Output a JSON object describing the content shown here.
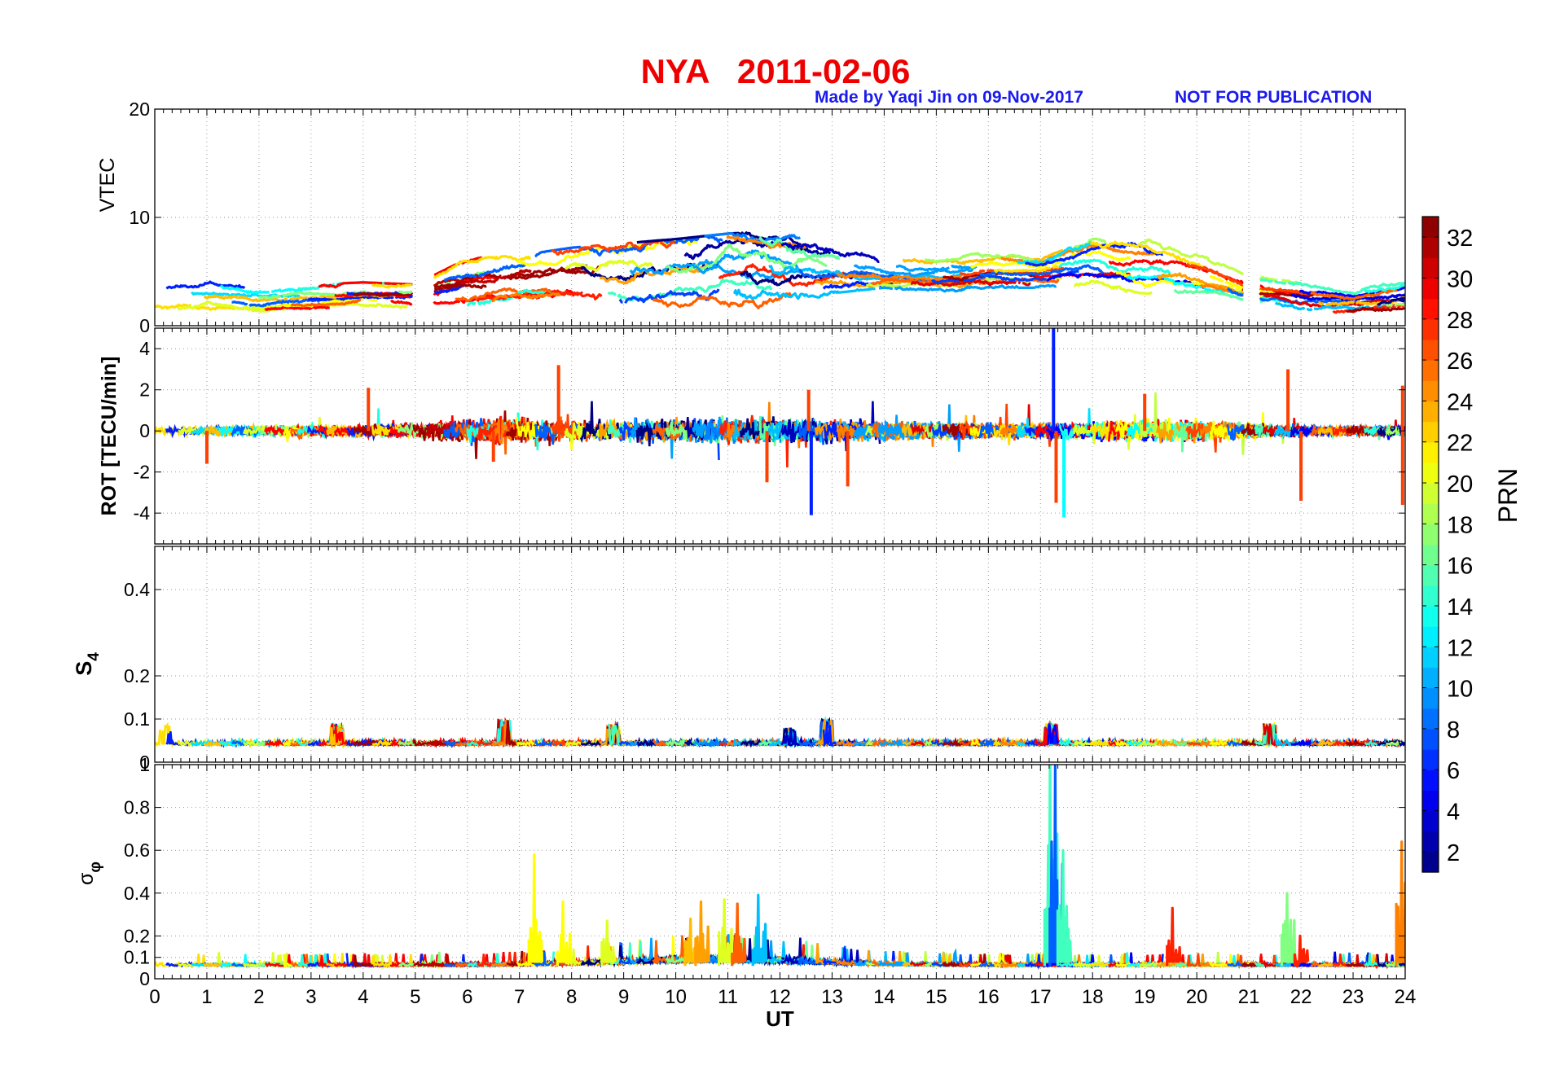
{
  "header": {
    "title": "NYA   2011-02-06",
    "credit": "Made by Yaqi Jin on 09-Nov-2017",
    "notice": "NOT FOR PUBLICATION"
  },
  "colors": {
    "title": "#ee0000",
    "annotation": "#1a1aee",
    "colormap": "jet"
  },
  "chart_data": [
    {
      "type": "line",
      "id": "vtec",
      "ylabel": "VTEC",
      "xlabel": "",
      "xlim": [
        0,
        24
      ],
      "ylim": [
        0,
        20
      ],
      "yticks": [
        0,
        10,
        20
      ],
      "grid": true,
      "series_by": "PRN",
      "envelope": {
        "x": [
          0,
          1,
          2,
          3,
          4,
          5,
          6,
          7,
          8,
          9,
          10,
          11,
          12,
          13,
          14,
          15,
          16,
          17,
          18,
          19,
          20,
          21,
          22,
          23,
          24
        ],
        "typical": [
          2.5,
          2.8,
          2.4,
          2.6,
          3.0,
          2.8,
          3.8,
          4.5,
          5.0,
          5.2,
          5.4,
          5.8,
          5.6,
          5.3,
          4.8,
          4.6,
          5.0,
          4.8,
          5.8,
          5.2,
          4.6,
          3.2,
          2.5,
          2.2,
          2.8
        ],
        "min": [
          1.2,
          1.5,
          1.3,
          1.4,
          1.6,
          1.2,
          1.5,
          1.6,
          0.8,
          0.2,
          0.5,
          0.3,
          0.8,
          3.0,
          3.5,
          3.0,
          3.5,
          3.5,
          3.2,
          3.0,
          2.5,
          1.8,
          1.0,
          1.0,
          1.5
        ],
        "max": [
          4.0,
          4.4,
          3.6,
          3.8,
          4.0,
          3.8,
          6.2,
          6.5,
          7.2,
          7.6,
          8.0,
          8.5,
          8.8,
          8.6,
          6.8,
          6.2,
          6.8,
          6.2,
          8.0,
          8.2,
          7.0,
          4.5,
          4.5,
          3.5,
          4.5
        ]
      },
      "gaps_hours": [
        [
          4.95,
          5.35
        ],
        [
          20.9,
          21.2
        ]
      ]
    },
    {
      "type": "line",
      "id": "rot",
      "ylabel": "ROT [TECU/min]",
      "xlabel": "",
      "xlim": [
        0,
        24
      ],
      "ylim": [
        -5.5,
        5
      ],
      "yticks": [
        -4,
        -2,
        0,
        2,
        4
      ],
      "grid": true,
      "series_by": "PRN",
      "spikes": [
        {
          "x": 17.25,
          "y": 5.0
        },
        {
          "x": 17.3,
          "y": -3.5
        },
        {
          "x": 17.45,
          "y": -4.2
        },
        {
          "x": 12.6,
          "y": -4.1
        },
        {
          "x": 13.3,
          "y": -2.7
        },
        {
          "x": 11.75,
          "y": -2.5
        },
        {
          "x": 21.75,
          "y": 3.0
        },
        {
          "x": 22.0,
          "y": -3.4
        },
        {
          "x": 23.95,
          "y": -3.6
        },
        {
          "x": 23.95,
          "y": 2.2
        },
        {
          "x": 7.75,
          "y": 3.2
        },
        {
          "x": 12.55,
          "y": 2.0
        },
        {
          "x": 19.0,
          "y": 1.8
        },
        {
          "x": 6.5,
          "y": -1.5
        },
        {
          "x": 4.1,
          "y": 2.1
        },
        {
          "x": 1.0,
          "y": -1.6
        }
      ]
    },
    {
      "type": "line",
      "id": "s4",
      "ylabel": "S4",
      "ylabel_main": "S",
      "ylabel_sub": "4",
      "xlabel": "",
      "xlim": [
        0,
        24
      ],
      "ylim": [
        0,
        0.5
      ],
      "yticks": [
        0,
        0.1,
        0.2,
        0.4
      ],
      "tick_labels": [
        "0",
        "0.1",
        "0.2",
        "0.4"
      ],
      "grid": true,
      "series_by": "PRN",
      "baseline": 0.04,
      "bumps": [
        {
          "x": 0.2,
          "y": 0.09
        },
        {
          "x": 3.5,
          "y": 0.09
        },
        {
          "x": 6.7,
          "y": 0.1
        },
        {
          "x": 8.8,
          "y": 0.09
        },
        {
          "x": 12.2,
          "y": 0.08
        },
        {
          "x": 12.9,
          "y": 0.1
        },
        {
          "x": 17.2,
          "y": 0.09
        },
        {
          "x": 21.4,
          "y": 0.09
        }
      ]
    },
    {
      "type": "line",
      "id": "sigma_phi",
      "ylabel": "σφ",
      "ylabel_main": "σ",
      "ylabel_sub": "φ",
      "xlabel": "UT",
      "xlim": [
        0,
        24
      ],
      "ylim": [
        0,
        1
      ],
      "yticks": [
        0,
        0.1,
        0.2,
        0.4,
        0.6,
        0.8,
        1
      ],
      "tick_labels": [
        "0",
        "0.1",
        "0.2",
        "0.4",
        "0.6",
        "0.8",
        "1"
      ],
      "xticks": [
        0,
        1,
        2,
        3,
        4,
        5,
        6,
        7,
        8,
        9,
        10,
        11,
        12,
        13,
        14,
        15,
        16,
        17,
        18,
        19,
        20,
        21,
        22,
        23,
        24
      ],
      "grid": true,
      "series_by": "PRN",
      "baseline": 0.06,
      "spikes": [
        {
          "x": 7.3,
          "y": 0.58,
          "prn": 21
        },
        {
          "x": 7.85,
          "y": 0.36,
          "prn": 21
        },
        {
          "x": 8.7,
          "y": 0.27,
          "prn": 20
        },
        {
          "x": 10.3,
          "y": 0.28,
          "prn": 23
        },
        {
          "x": 10.5,
          "y": 0.36,
          "prn": 24
        },
        {
          "x": 10.95,
          "y": 0.37,
          "prn": 20
        },
        {
          "x": 11.2,
          "y": 0.35,
          "prn": 26
        },
        {
          "x": 11.6,
          "y": 0.39,
          "prn": 11
        },
        {
          "x": 17.2,
          "y": 1.0,
          "prn": 15
        },
        {
          "x": 17.3,
          "y": 1.0,
          "prn": 8
        },
        {
          "x": 17.45,
          "y": 0.6,
          "prn": 15
        },
        {
          "x": 19.55,
          "y": 0.33,
          "prn": 28
        },
        {
          "x": 21.75,
          "y": 0.4,
          "prn": 17
        },
        {
          "x": 22.0,
          "y": 0.2,
          "prn": 28
        },
        {
          "x": 23.95,
          "y": 0.64,
          "prn": 25
        }
      ]
    }
  ],
  "colorbar": {
    "label": "PRN",
    "range": [
      1,
      33
    ],
    "ticks": [
      2,
      4,
      6,
      8,
      10,
      12,
      14,
      16,
      18,
      20,
      22,
      24,
      26,
      28,
      30,
      32
    ]
  }
}
